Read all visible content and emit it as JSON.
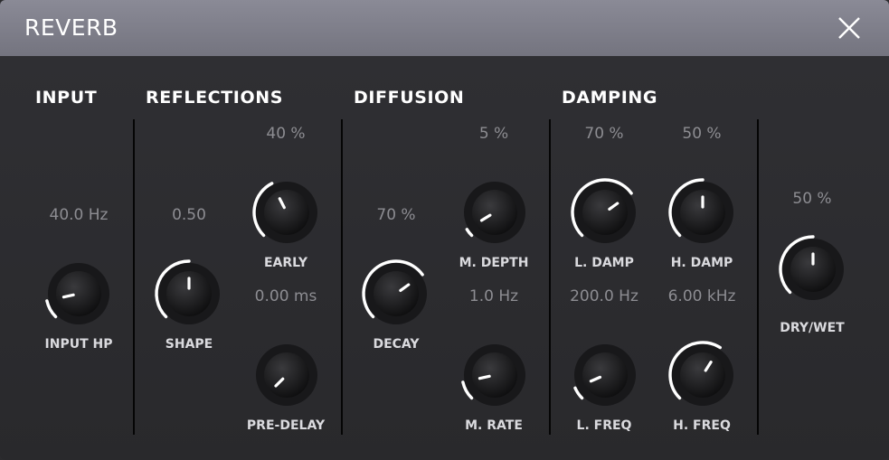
{
  "window": {
    "title": "REVERB"
  },
  "sections": {
    "input": "INPUT",
    "reflections": "REFLECTIONS",
    "diffusion": "DIFFUSION",
    "damping": "DAMPING"
  },
  "knobs": {
    "input_hp": {
      "label": "INPUT HP",
      "value": "40.0 Hz",
      "level": 0.12
    },
    "shape": {
      "label": "SHAPE",
      "value": "0.50",
      "level": 0.5
    },
    "early": {
      "label": "EARLY",
      "value": "40 %",
      "level": 0.4
    },
    "pre_delay": {
      "label": "PRE-DELAY",
      "value": "0.00 ms",
      "level": 0.0
    },
    "decay": {
      "label": "DECAY",
      "value": "70 %",
      "level": 0.7
    },
    "m_depth": {
      "label": "M. DEPTH",
      "value": "5 %",
      "level": 0.05
    },
    "m_rate": {
      "label": "M. RATE",
      "value": "1.0 Hz",
      "level": 0.12
    },
    "l_damp": {
      "label": "L. DAMP",
      "value": "70 %",
      "level": 0.7
    },
    "h_damp": {
      "label": "H. DAMP",
      "value": "50 %",
      "level": 0.5
    },
    "l_freq": {
      "label": "L. FREQ",
      "value": "200.0 Hz",
      "level": 0.08
    },
    "h_freq": {
      "label": "H. FREQ",
      "value": "6.00 kHz",
      "level": 0.62
    },
    "dry_wet": {
      "label": "DRY/WET",
      "value": "50 %",
      "level": 0.5
    }
  },
  "colors": {
    "titlebar": "#7e7e8a",
    "panel": "#2e2e31",
    "arc": "#ffffff",
    "value_text": "#8d8d92"
  }
}
